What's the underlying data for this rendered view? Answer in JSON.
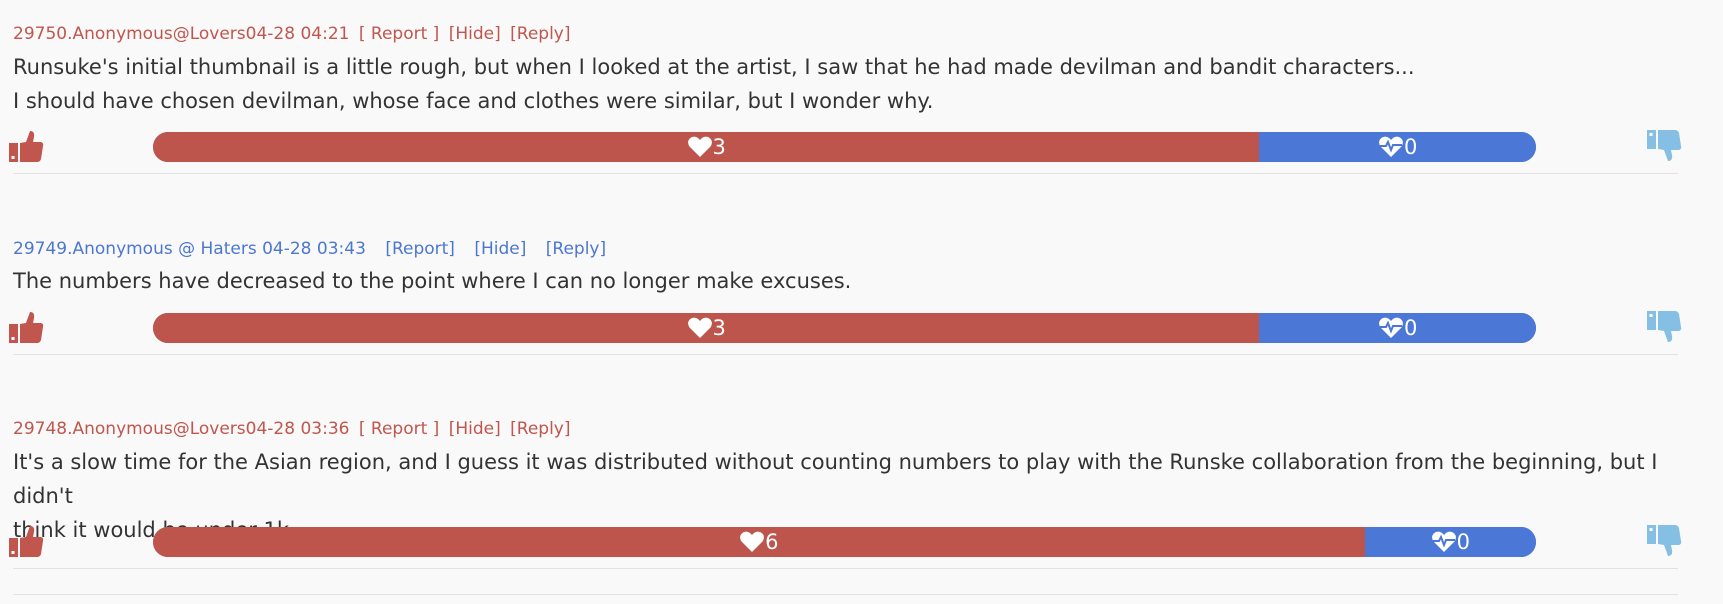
{
  "colors": {
    "lovers_meta": "#c0564d",
    "haters_meta": "#4c77d1",
    "like_bar": "#bd554d",
    "dislike_bar": "#4b77d6",
    "thumb_up": "#c0564d",
    "thumb_down": "#85c0e4"
  },
  "comments": [
    {
      "header": "29750.Anonymous@Lovers04-28 04:21",
      "report": "[ Report ]",
      "hide": "[Hide]",
      "reply": "[Reply]",
      "text_lines": [
        "Runsuke's initial thumbnail is a little rough, but when I looked at the artist, I saw that he had made devilman and bandit characters...",
        "I should have chosen devilman, whose face and clothes were similar, but I wonder why."
      ],
      "likes": 3,
      "dislikes": 0,
      "like_fraction": 0.8,
      "likes_text": "3",
      "dislikes_text": "0"
    },
    {
      "header": "29749.Anonymous @ Haters 04-28 03:43",
      "report": "[Report]",
      "hide": "[Hide]",
      "reply": "[Reply]",
      "text_lines": [
        "The numbers have decreased to the point where I can no longer make excuses."
      ],
      "likes": 3,
      "dislikes": 0,
      "like_fraction": 0.8,
      "likes_text": "3",
      "dislikes_text": "0"
    },
    {
      "header": "29748.Anonymous@Lovers04-28 03:36",
      "report": "[ Report ]",
      "hide": "[Hide]",
      "reply": "[Reply]",
      "text_lines": [
        "It's a slow time for the Asian region, and I guess it was distributed without counting numbers to play with the Runske collaboration from the beginning, but I didn't",
        "think it would be under 1k."
      ],
      "likes": 6,
      "dislikes": 0,
      "like_fraction": 0.876,
      "likes_text": "6",
      "dislikes_text": "0"
    }
  ]
}
